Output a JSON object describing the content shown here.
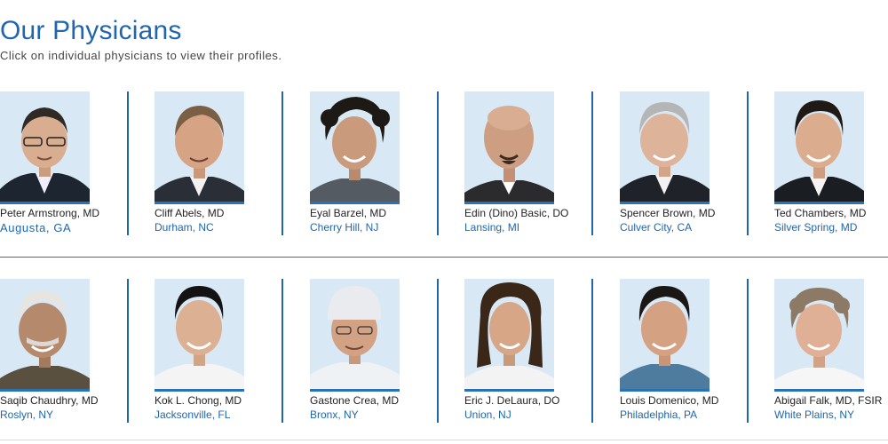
{
  "header": {
    "title": "Our Physicians",
    "subtitle": "Click on individual physicians to view their profiles."
  },
  "colors": {
    "accent": "#1f66ad",
    "photo_bg": "#d9e8f5"
  },
  "rows": [
    [
      {
        "name": "Peter Armstrong, MD",
        "location": "Augusta, GA",
        "icon": "physician-photo"
      },
      {
        "name": "Cliff Abels, MD",
        "location": "Durham, NC",
        "icon": "physician-photo"
      },
      {
        "name": "Eyal Barzel, MD",
        "location": "Cherry Hill, NJ",
        "icon": "physician-photo"
      },
      {
        "name": "Edin (Dino) Basic, DO",
        "location": "Lansing, MI",
        "icon": "physician-photo"
      },
      {
        "name": "Spencer Brown, MD",
        "location": "Culver City, CA",
        "icon": "physician-photo"
      },
      {
        "name": "Ted Chambers, MD",
        "location": "Silver Spring, MD",
        "icon": "physician-photo"
      }
    ],
    [
      {
        "name": "Saqib Chaudhry, MD",
        "location": "Roslyn, NY",
        "icon": "physician-photo"
      },
      {
        "name": "Kok L. Chong, MD",
        "location": "Jacksonville, FL",
        "icon": "physician-photo"
      },
      {
        "name": "Gastone Crea, MD",
        "location": "Bronx, NY",
        "icon": "physician-photo"
      },
      {
        "name": "Eric J. DeLaura, DO",
        "location": "Union, NJ",
        "icon": "physician-photo"
      },
      {
        "name": "Louis Domenico, MD",
        "location": "Philadelphia, PA",
        "icon": "physician-photo"
      },
      {
        "name": "Abigail Falk, MD, FSIR",
        "location": "White Plains, NY",
        "icon": "physician-photo"
      }
    ]
  ]
}
